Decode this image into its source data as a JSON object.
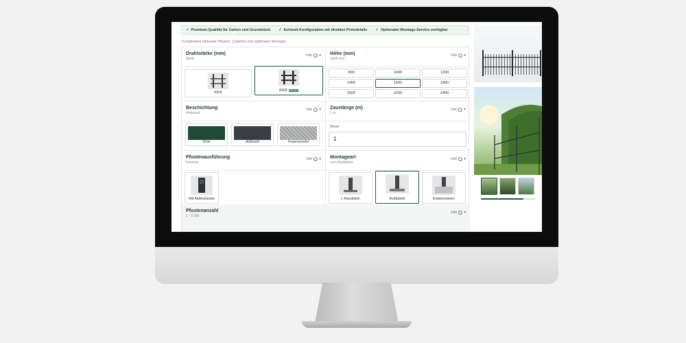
{
  "banner": {
    "items": [
      "Premium-Qualität für Garten und Grundstück",
      "Echtzeit-Konfiguration mit direkten Preisdetails",
      "Optionaler Montage-Service verfügbar"
    ]
  },
  "subline": "Komplettset inklusive Pfosten, Zubehör und optionaler Montage.",
  "info_label": "Info",
  "sections": {
    "drahtstaerke": {
      "title": "Drahtstärke (mm)",
      "value": "8/6/8",
      "options": [
        {
          "label": "6/5/6",
          "selected": false
        },
        {
          "label": "8/6/8",
          "selected": true,
          "badge": "BELIEBT"
        }
      ]
    },
    "hoehe": {
      "title": "Höhe (mm)",
      "value": "1600 mm",
      "options": [
        "800",
        "1000",
        "1200",
        "1400",
        "1600",
        "1800",
        "2000",
        "2200",
        "2400"
      ],
      "selected": "1600"
    },
    "beschichtung": {
      "title": "Beschichtung",
      "value": "Anthrazit",
      "options": [
        {
          "label": "Grün",
          "color": "#1f4a34"
        },
        {
          "label": "Anthrazit",
          "color": "#3a3d42"
        },
        {
          "label": "Feuerverzinkt",
          "color": "#a9aeaa"
        }
      ]
    },
    "zaunlaenge": {
      "title": "Zaunlänge (m)",
      "value": "1 m",
      "meter_label": "Meter",
      "meter_value": "1"
    },
    "pfostenausfuehrung": {
      "title": "Pfostenausführung",
      "value": "Klemme",
      "options": [
        {
          "label": "Mit Abdeckleiste"
        }
      ]
    },
    "montageart": {
      "title": "Montageart",
      "value": "zum Aufdübeln",
      "options": [
        {
          "label": "L-Randstein",
          "selected": false
        },
        {
          "label": "Aufdübeln",
          "selected": true
        },
        {
          "label": "Einbetonieren",
          "selected": false
        }
      ]
    },
    "pfostenanzahl": {
      "title": "Pfostenanzahl",
      "value": "1 - 0 Stk"
    }
  },
  "colors": {
    "brand": "#1e5a3a",
    "banner_bg": "#edf5ef"
  }
}
